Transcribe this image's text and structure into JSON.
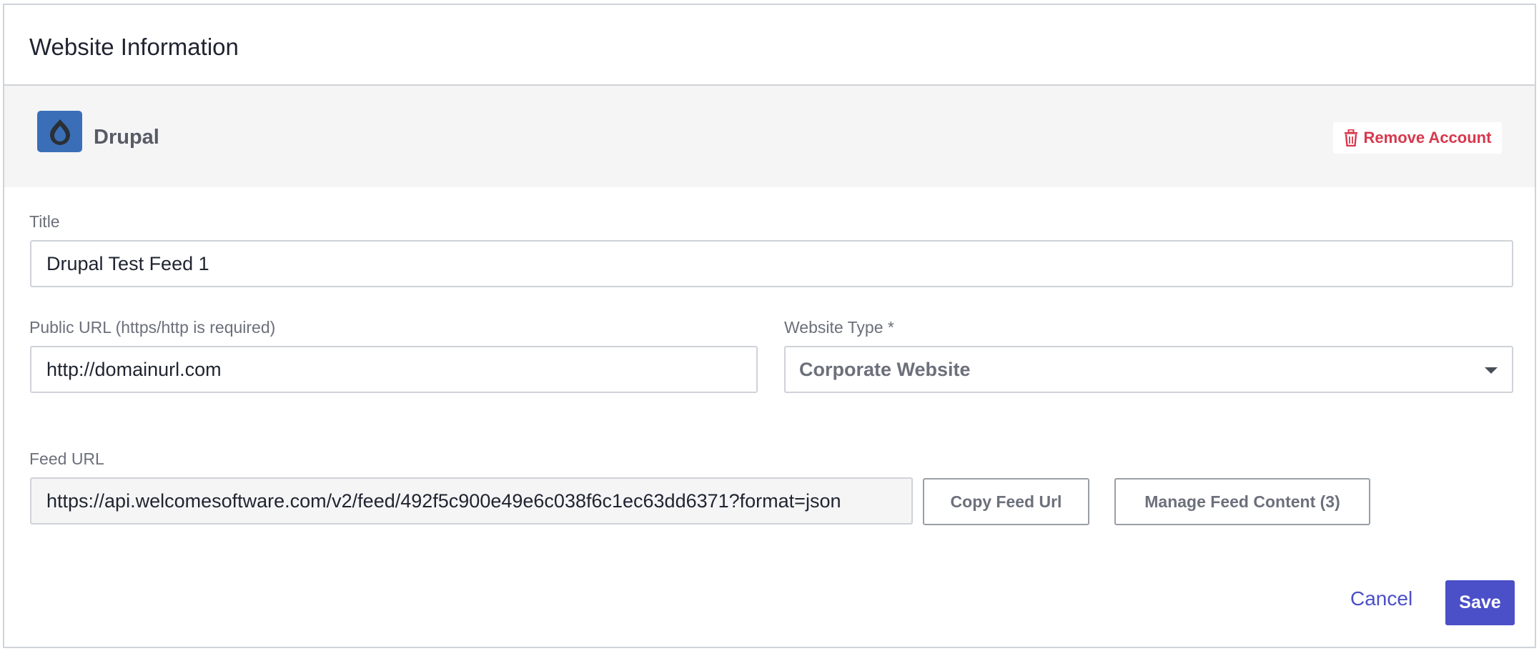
{
  "header": {
    "title": "Website Information"
  },
  "account": {
    "name": "Drupal",
    "logo_icon": "drupal-drop-icon",
    "remove_label": "Remove Account",
    "remove_icon": "trash-icon"
  },
  "form": {
    "title_label": "Title",
    "title_value": "Drupal Test Feed 1",
    "public_url_label": "Public URL (https/http is required)",
    "public_url_value": "http://domainurl.com",
    "website_type_label": "Website Type *",
    "website_type_value": "Corporate Website",
    "feed_url_label": "Feed URL",
    "feed_url_value": "https://api.welcomesoftware.com/v2/feed/492f5c900e49e6c038f6c1ec63dd6371?format=json",
    "copy_feed_label": "Copy Feed Url",
    "manage_feed_label": "Manage Feed Content (3)"
  },
  "footer": {
    "cancel_label": "Cancel",
    "save_label": "Save"
  },
  "colors": {
    "accent": "#4b4fc8",
    "danger": "#d7384d",
    "drupal_blue": "#3a6fb8"
  }
}
